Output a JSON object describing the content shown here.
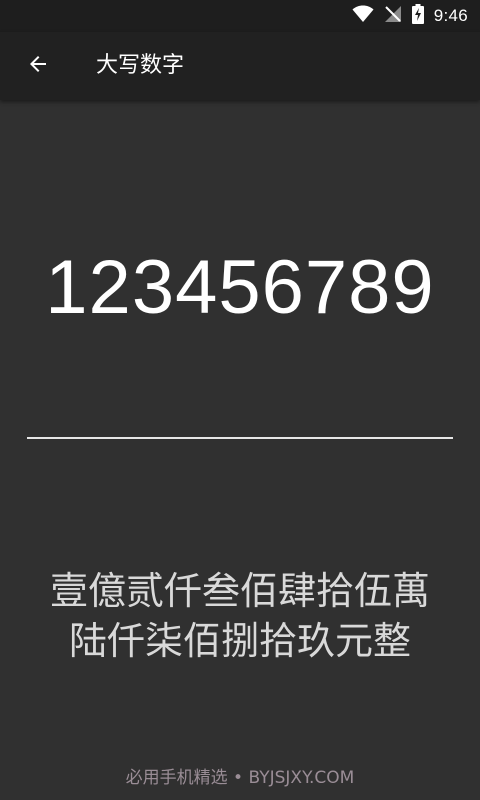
{
  "status_bar": {
    "time": "9:46",
    "icons": [
      "wifi-icon",
      "no-signal-icon",
      "battery-charging-icon"
    ]
  },
  "app_bar": {
    "back_icon": "arrow-left-icon",
    "title": "大写数字"
  },
  "main": {
    "number_value": "123456789",
    "result_line1": "壹億贰仟叁佰肆拾伍萬",
    "result_line2": "陆仟柒佰捌拾玖元整"
  },
  "watermark": "必用手机精选 • BYJSJXY.COM",
  "colors": {
    "background": "#303030",
    "app_bar": "#212121",
    "status_bar": "#1e1e1e",
    "primary_text": "#ffffff",
    "result_text": "#d9d9d9",
    "underline": "#e6e6e6",
    "watermark": "#9a8d96"
  }
}
